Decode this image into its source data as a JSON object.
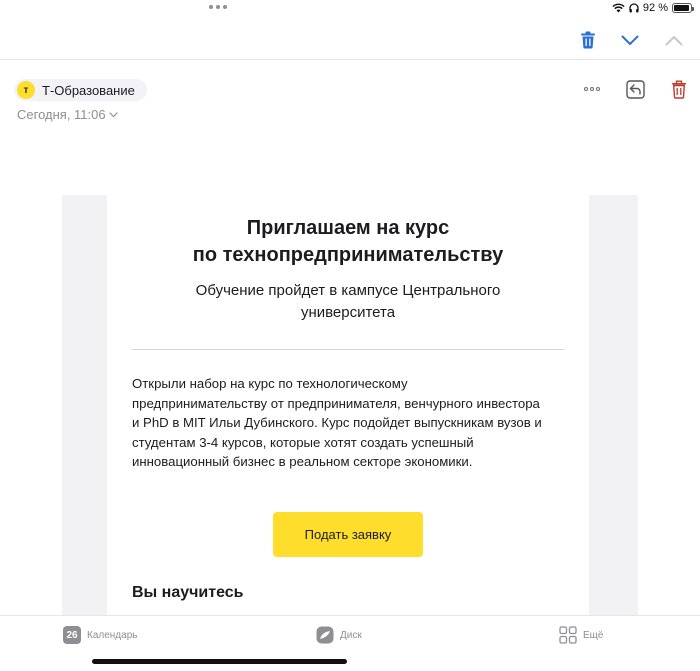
{
  "status_bar": {
    "battery_text": "92 %",
    "battery_level": 0.92
  },
  "toolbar": {
    "icons": [
      "trash-icon",
      "chevron-down-icon",
      "chevron-up-icon"
    ],
    "trash_color": "#2b6fd6",
    "chevron_down_color": "#2b6fd6",
    "chevron_up_color": "#c7c7cc"
  },
  "sender": {
    "avatar_letter": "т",
    "name": "Т-Образование",
    "date": "Сегодня, 11:06"
  },
  "message_actions": {
    "icons": [
      "more-icon",
      "reply-icon",
      "trash-icon"
    ],
    "delete_color": "#c0392b"
  },
  "email": {
    "title_line1": "Приглашаем на курс",
    "title_line2": "по технопредпринимательству",
    "subtitle": "Обучение пройдет в кампусе Центрального университета",
    "body": "Открыли набор на курс по технологическому предпринимательству от предпринимателя, венчурного инвестора и PhD в MIT Ильи Дубинского. Курс подойдет выпускникам вузов и студентам 3-4 курсов, которые хотят создать успешный инновационный бизнес в реальном секторе экономики.",
    "button_label": "Подать заявку",
    "section_heading": "Вы научитесь",
    "brand_color": "#ffdd2d"
  },
  "tab_bar": {
    "calendar_day": "26",
    "calendar_label": "Календарь",
    "disk_label": "Диск",
    "more_label": "Ещё"
  }
}
